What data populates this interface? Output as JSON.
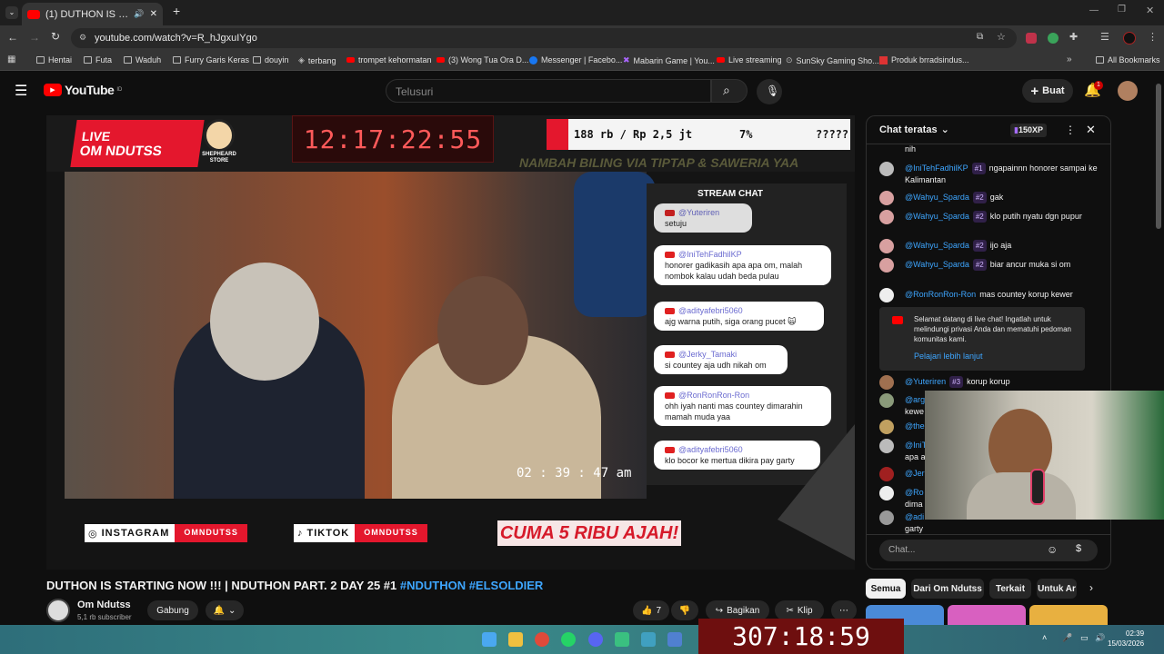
{
  "browser": {
    "tab_title": "(1) DUTHON IS STARTING NOW !!! | NDUTHON PART. 2 DAY 25",
    "url": "youtube.com/watch?v=R_hJgxuIYgo",
    "new_tab": "+",
    "bookmarks": [
      "Hentai",
      "Futa",
      "Waduh",
      "Furry Garis Keras",
      "douyin",
      "terbang",
      "trompet kehormatan",
      "(3) Wong Tua Ora D...",
      "Messenger | Facebo...",
      "Mabarin Game | You...",
      "Live streaming",
      "SunSky Gaming Sho...",
      "Produk brradsindus..."
    ],
    "all_bookmarks": "All Bookmarks"
  },
  "youtube": {
    "logo": "YouTube",
    "logo_sup": "ID",
    "search_placeholder": "Telusuri",
    "create_label": "Buat",
    "notif_count": "1"
  },
  "overlay": {
    "live_label": "LIVE",
    "channel_name": "OM NDUTSS",
    "mascot_label": "SHEPHEARD STORE",
    "clock": "12:17:22:55",
    "stats": [
      "188 rb / Rp 2,5 jt",
      "7%",
      "?????"
    ],
    "ticker": "NAMBAH BILING VIA TIPTAP & SAWERIA YAA",
    "stream_chat_title": "STREAM CHAT",
    "instagram_label": "INSTAGRAM",
    "instagram_handle": "OMNDUTSS",
    "tiktok_label": "TIKTOK",
    "tiktok_handle": "OMNDUTSS",
    "promo": "CUMA 5 RIBU AJAH!",
    "timestamp": "02 : 39 : 47 am",
    "stream_chat": [
      {
        "user": "@Yuteriren",
        "text": "setuju"
      },
      {
        "user": "@IniTehFadhilKP",
        "text": "honorer gadikasih apa apa om, malah nombok kalau udah beda pulau"
      },
      {
        "user": "@adityafebri5060",
        "text": "ajg warna putih, siga orang pucet 🙀"
      },
      {
        "user": "@Jerky_Tamaki",
        "text": "si countey aja udh nikah om"
      },
      {
        "user": "@RonRonRon-Ron",
        "text": "ohh iyah nanti mas countey dimarahin mamah muda yaa"
      },
      {
        "user": "@adityafebri5060",
        "text": "klo bocor ke mertua dikira pay garty"
      }
    ]
  },
  "video": {
    "title_main": "DUTHON IS STARTING NOW !!! | NDUTHON PART. 2 DAY 25 #1 ",
    "title_hash": "#NDUTHON #ELSOLDIER",
    "channel": "Om Ndutss",
    "subscribers": "5,1 rb subscriber",
    "join_label": "Gabung",
    "likes": "7",
    "share_label": "Bagikan",
    "clip_label": "Klip"
  },
  "chat": {
    "header": "Chat teratas",
    "xp": "150XP",
    "top_fragment": "nih",
    "messages": [
      {
        "name": "@IniTehFadhilKP",
        "badge": "#1",
        "text": "ngapainnn honorer sampai ke Kalimantan"
      },
      {
        "name": "@Wahyu_Sparda",
        "badge": "#2",
        "text": "gak"
      },
      {
        "name": "@Wahyu_Sparda",
        "badge": "#2",
        "text": "klo putih nyatu dgn pupur"
      },
      {
        "name": "@Wahyu_Sparda",
        "badge": "#2",
        "text": "ijo aja"
      },
      {
        "name": "@Wahyu_Sparda",
        "badge": "#2",
        "text": "biar ancur muka si om"
      },
      {
        "name": "@RonRonRon-Ron",
        "badge": "",
        "text": "mas countey korup kewer"
      }
    ],
    "notice": "Selamat datang di live chat! Ingatlah untuk melindungi privasi Anda dan mematuhi pedoman komunitas kami.",
    "notice_link": "Pelajari lebih lanjut",
    "after_notice": [
      {
        "name": "@Yuteriren",
        "badge": "#3",
        "text": "korup korup"
      },
      {
        "name": "@arg",
        "badge": "",
        "text": "kewe"
      },
      {
        "name": "@the",
        "badge": "",
        "text": ""
      },
      {
        "name": "@IniT",
        "badge": "",
        "text": "apa a"
      },
      {
        "name": "@Jer",
        "badge": "",
        "text": ""
      },
      {
        "name": "@Ro",
        "badge": "",
        "text": "dima"
      },
      {
        "name": "@adi",
        "badge": "",
        "text": "garty"
      }
    ],
    "input_placeholder": "Chat...",
    "chips": [
      "Semua",
      "Dari Om Ndutss",
      "Terkait",
      "Untuk Ar"
    ]
  },
  "taskbar": {
    "big_clock": "307:18:59",
    "time": "02:39",
    "date": "15/03/2026"
  },
  "colors": {
    "yt_red": "#ff0000",
    "accent_blue": "#3ea6ff",
    "overlay_red": "#e4172d"
  }
}
